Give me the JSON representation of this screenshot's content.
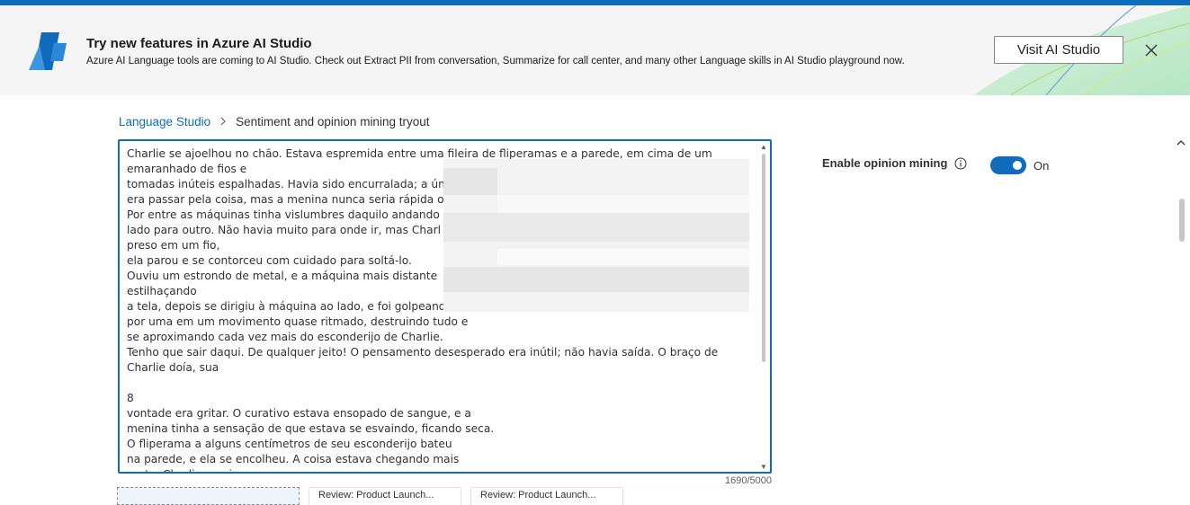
{
  "banner": {
    "title": "Try new features in Azure AI Studio",
    "subtitle": "Azure AI Language tools are coming to AI Studio. Check out Extract PII from conversation, Summarize for call center, and many other Language skills in AI Studio playground now.",
    "visit_button": "Visit AI Studio",
    "close_icon": "close-icon",
    "logo_icon": "azure-ai-logo-icon"
  },
  "breadcrumb": {
    "root": "Language Studio",
    "separator": ">",
    "current": "Sentiment and opinion mining tryout"
  },
  "input": {
    "text": "Charlie se ajoelhou no chão. Estava espremida entre uma fileira de fliperamas e a parede, em cima de um emaranhado de fios e\ntomadas inúteis espalhadas. Havia sido encurralada; a ún\nera passar pela coisa, mas a menina nunca seria rápida o\nPor entre as máquinas tinha vislumbres daquilo andando\nlado para outro. Não havia muito para onde ir, mas Charl\npreso em um fio,\nela parou e se contorceu com cuidado para soltá-lo.\nOuviu um estrondo de metal, e a máquina mais distante\nestilhaçando\na tela, depois se dirigiu à máquina ao lado, e foi golpeand\npor uma em um movimento quase ritmado, destruindo tudo e\nse aproximando cada vez mais do esconderijo de Charlie.\nTenho que sair daqui. De qualquer jeito! O pensamento desesperado era inútil; não havia saída. O braço de Charlie doía, sua\n\n8\nvontade era gritar. O curativo estava ensopado de sangue, e a\nmenina tinha a sensação de que estava se esvaindo, ficando seca.\nO fliperama a alguns centímetros de seu esconderijo bateu\nna parede, e ela se encolheu. A coisa estava chegando mais\nperto. Charlie precisava correr, mas o corpo se recusava",
    "char_count": "1690/5000"
  },
  "tabs": {
    "tab_b": "Review: Product Launch...",
    "tab_c": "Review: Product Launch..."
  },
  "settings": {
    "opinion_label": "Enable opinion mining",
    "info_icon": "info-icon",
    "toggle_state": "On",
    "toggle_on": true
  },
  "colors": {
    "accent": "#0f6cbd",
    "banner_bg": "#f5f5f5"
  }
}
